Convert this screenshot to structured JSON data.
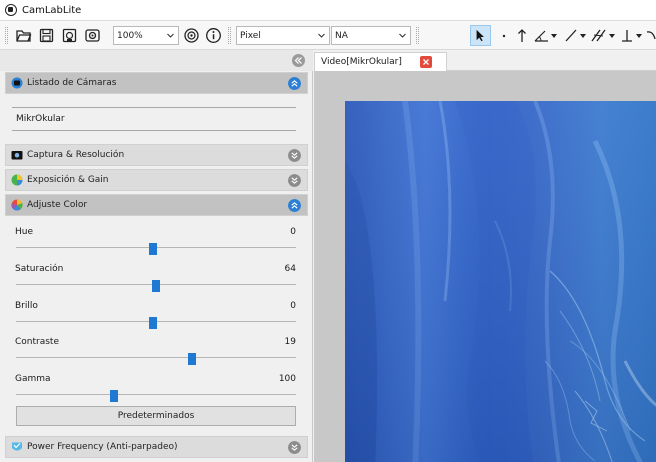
{
  "window": {
    "title": "CamLabLite"
  },
  "toolbar": {
    "zoom": "100%",
    "unit": "Pixel",
    "calibration": "NA",
    "buttons": [
      "open-icon",
      "save-icon",
      "record-icon",
      "snapshot-icon",
      "settings-icon",
      "info-icon"
    ],
    "tools": [
      "cursor-icon",
      "point-icon",
      "arrow-icon",
      "angle-icon",
      "line-icon",
      "parallel-icon",
      "perpendicular-icon",
      "arc-icon"
    ]
  },
  "panel": {
    "sections": [
      {
        "label": "Listado de Cámaras",
        "expanded": true
      },
      {
        "label": "Captura & Resolución",
        "expanded": false
      },
      {
        "label": "Exposición & Gain",
        "expanded": false
      },
      {
        "label": "Adjuste Color",
        "expanded": true
      },
      {
        "label": "Power Frequency (Anti-parpadeo)",
        "expanded": false
      }
    ],
    "cameras": [
      "MikrOkular"
    ],
    "sliders": [
      {
        "label": "Hue",
        "value": "0",
        "fraction": 0.49
      },
      {
        "label": "Saturación",
        "value": "64",
        "fraction": 0.5
      },
      {
        "label": "Brillo",
        "value": "0",
        "fraction": 0.49
      },
      {
        "label": "Contraste",
        "value": "19",
        "fraction": 0.63
      },
      {
        "label": "Gamma",
        "value": "100",
        "fraction": 0.35
      }
    ],
    "defaults_button": "Predeterminados"
  },
  "viewer": {
    "tab_label": "Video[MikrOkular]"
  },
  "colors": {
    "accent": "#1f78d1",
    "tab_close": "#e24a3c",
    "video_blue": "#2f64c8"
  }
}
